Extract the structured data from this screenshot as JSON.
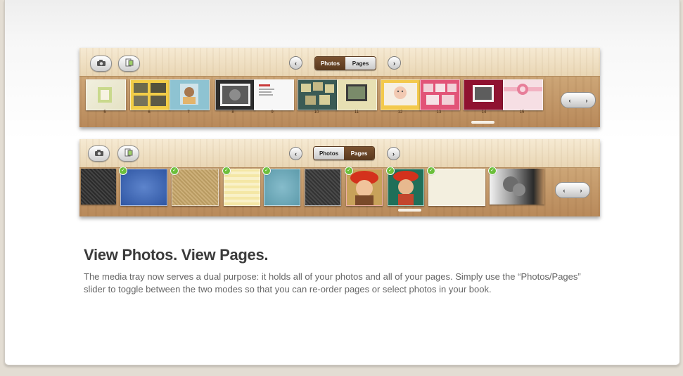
{
  "section": {
    "title": "View Photos. View Pages.",
    "description": "The media tray now serves a dual purpose: it holds all of your photos and all of your pages. Simply use the “Photos/Pages” slider to toggle between the two modes so that you can re-order pages or select photos in your book."
  },
  "tray_pages": {
    "toggle": {
      "photos_label": "Photos",
      "pages_label": "Pages",
      "active": "Photos"
    },
    "page_numbers": [
      "5",
      "6",
      "7",
      "8",
      "9",
      "10",
      "11",
      "12",
      "13",
      "14",
      "15"
    ]
  },
  "tray_photos": {
    "toggle": {
      "photos_label": "Photos",
      "pages_label": "Pages",
      "active": "Pages"
    },
    "check_icon": "✓"
  },
  "icons": {
    "camera": "camera-icon",
    "pages_add": "add-page-icon",
    "arrow_left": "‹",
    "arrow_right": "›"
  },
  "colors": {
    "wood": "#b98d5f",
    "toggle_active": "#5a3a1f",
    "check": "#6bbf3b",
    "heading": "#3b3b3b",
    "body_text": "#666666"
  }
}
